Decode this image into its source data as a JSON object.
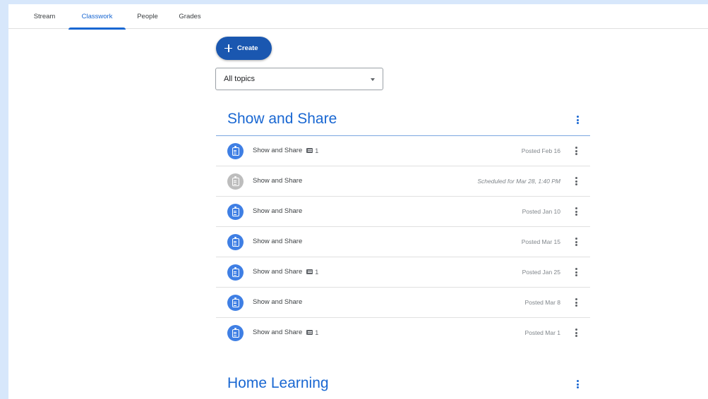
{
  "tabs": [
    {
      "label": "Stream"
    },
    {
      "label": "Classwork"
    },
    {
      "label": "People"
    },
    {
      "label": "Grades"
    }
  ],
  "active_tab": "Classwork",
  "create_button": {
    "label": "Create"
  },
  "topic_filter": {
    "selected": "All topics"
  },
  "sections": [
    {
      "title": "Show and Share",
      "items": [
        {
          "title": "Show and Share",
          "comments": "1",
          "status": "Posted Feb 16",
          "scheduled": false
        },
        {
          "title": "Show and Share",
          "comments": "",
          "status": "Scheduled for Mar 28, 1:40 PM",
          "scheduled": true
        },
        {
          "title": "Show and Share",
          "comments": "",
          "status": "Posted Jan 10",
          "scheduled": false
        },
        {
          "title": "Show and Share",
          "comments": "",
          "status": "Posted Mar 15",
          "scheduled": false
        },
        {
          "title": "Show and Share",
          "comments": "1",
          "status": "Posted Jan 25",
          "scheduled": false
        },
        {
          "title": "Show and Share",
          "comments": "",
          "status": "Posted Mar 8",
          "scheduled": false
        },
        {
          "title": "Show and Share",
          "comments": "1",
          "status": "Posted Mar 1",
          "scheduled": false
        }
      ]
    },
    {
      "title": "Home Learning",
      "items": []
    }
  ],
  "colors": {
    "accent": "#1967d2",
    "create_button": "#1a57b0",
    "assignment_icon": "#3f7fe4",
    "scheduled_icon": "#bdbdbd"
  },
  "icons": {
    "assignment": "assignment-icon",
    "comment": "comment-icon",
    "more": "more-vert-icon",
    "add": "plus-icon",
    "dropdown": "chevron-down-icon"
  }
}
